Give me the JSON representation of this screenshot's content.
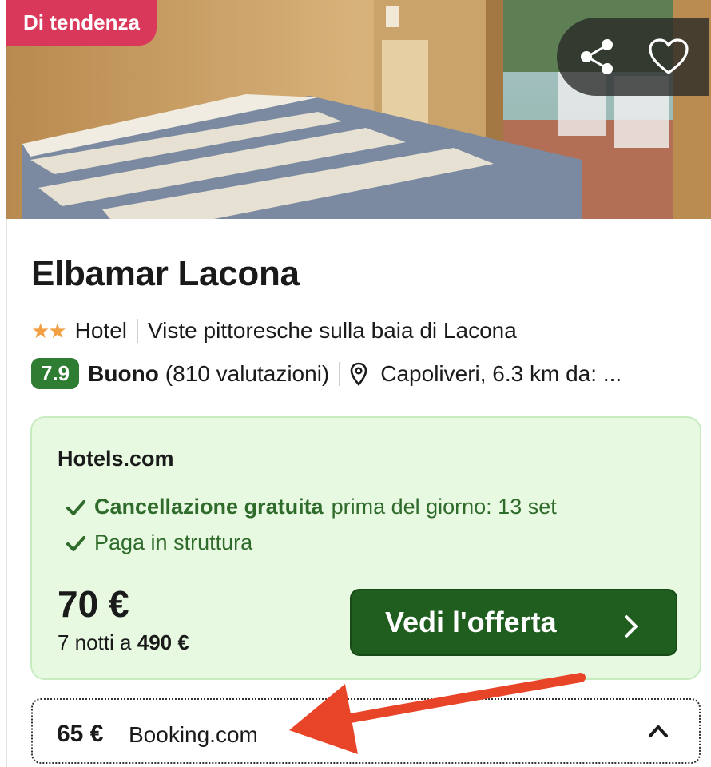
{
  "badge": {
    "label": "Di tendenza"
  },
  "hotel": {
    "name": "Elbamar Lacona",
    "stars": 2,
    "type": "Hotel",
    "tagline": "Viste pittoresche sulla baia di Lacona",
    "score": "7.9",
    "rating_word": "Buono",
    "reviews": "(810 valutazioni)",
    "location": "Capoliveri, 6.3 km da: ..."
  },
  "offer": {
    "provider": "Hotels.com",
    "features": [
      {
        "strong": "Cancellazione gratuita",
        "rest": "prima del giorno: 13 set"
      },
      {
        "strong": "",
        "rest": "Paga in struttura"
      }
    ],
    "price": "70 €",
    "nights_prefix": "7 notti a ",
    "total": "490 €",
    "cta": "Vedi l'offerta"
  },
  "alt_offer": {
    "price": "65 €",
    "provider": "Booking.com"
  },
  "colors": {
    "badge": "#d9385a",
    "score": "#2e7d32",
    "cta": "#1f5e1e",
    "offer_bg": "#e8f9e2",
    "arrow": "#e84427",
    "star": "#f2a044"
  },
  "icons": {
    "share": "share-icon",
    "favorite": "heart-icon",
    "location": "map-pin-icon",
    "check": "check-icon",
    "chevron": "chevron-right-icon",
    "caret": "chevron-up-icon"
  }
}
